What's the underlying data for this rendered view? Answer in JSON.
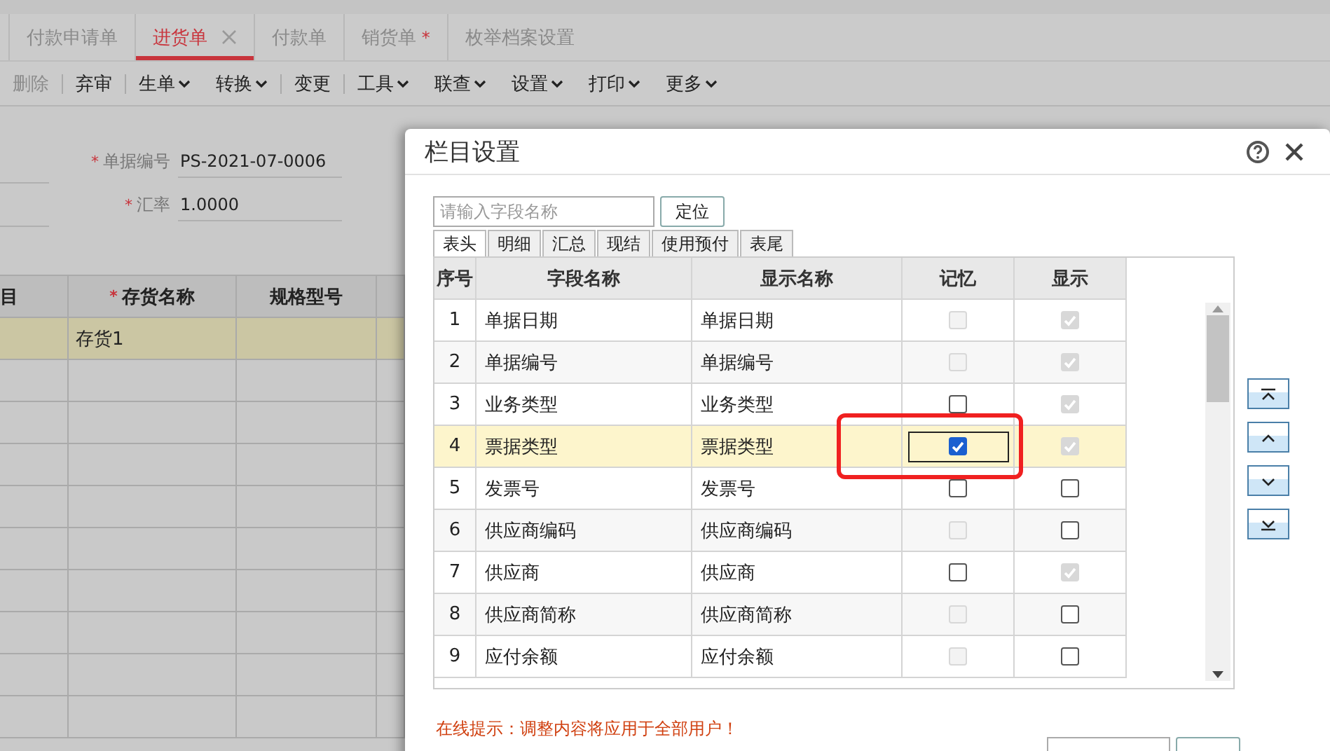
{
  "doc_tabs": [
    {
      "label": "付款申请单",
      "selected": false
    },
    {
      "label": "进货单",
      "selected": true,
      "closable": true
    },
    {
      "label": "付款单",
      "selected": false
    },
    {
      "label": "销货单",
      "selected": false,
      "modified_mark": "*"
    },
    {
      "label": "枚举档案设置",
      "selected": false
    }
  ],
  "toolbar": [
    {
      "label": "删除",
      "disabled": true,
      "dropdown": false
    },
    {
      "label": "弃审",
      "disabled": false,
      "dropdown": false
    },
    {
      "label": "生单",
      "disabled": false,
      "dropdown": true
    },
    {
      "label": "转换",
      "disabled": false,
      "dropdown": true
    },
    {
      "label": "变更",
      "disabled": false,
      "dropdown": false
    },
    {
      "label": "工具",
      "disabled": false,
      "dropdown": true
    },
    {
      "label": "联查",
      "disabled": false,
      "dropdown": true
    },
    {
      "label": "设置",
      "disabled": false,
      "dropdown": true
    },
    {
      "label": "打印",
      "disabled": false,
      "dropdown": true
    },
    {
      "label": "更多",
      "disabled": false,
      "dropdown": true
    }
  ],
  "form": [
    {
      "label": "单据编号",
      "required": true,
      "value": "PS-2021-07-0006"
    },
    {
      "label": "汇率",
      "required": true,
      "value": "1.0000"
    }
  ],
  "grid": {
    "columns": [
      {
        "label": "目",
        "required": false
      },
      {
        "label": "存货名称",
        "required": true
      },
      {
        "label": "规格型号",
        "required": false
      },
      {
        "required": false
      }
    ],
    "rows": [
      {
        "selected": true,
        "cells": [
          "",
          "存货1",
          "",
          ""
        ]
      },
      {
        "selected": false,
        "cells": [
          "",
          "",
          "",
          ""
        ]
      },
      {
        "selected": false,
        "cells": [
          "",
          "",
          "",
          ""
        ]
      },
      {
        "selected": false,
        "cells": [
          "",
          "",
          "",
          ""
        ]
      },
      {
        "selected": false,
        "cells": [
          "",
          "",
          "",
          ""
        ]
      },
      {
        "selected": false,
        "cells": [
          "",
          "",
          "",
          ""
        ]
      },
      {
        "selected": false,
        "cells": [
          "",
          "",
          "",
          ""
        ]
      },
      {
        "selected": false,
        "cells": [
          "",
          "",
          "",
          ""
        ]
      },
      {
        "selected": false,
        "cells": [
          "",
          "",
          "",
          ""
        ]
      },
      {
        "selected": false,
        "cells": [
          "",
          "",
          "",
          ""
        ]
      }
    ]
  },
  "dialog": {
    "title": "栏目设置",
    "search": {
      "placeholder": "请输入字段名称"
    },
    "locate_button": "定位",
    "tabs": [
      {
        "label": "表头",
        "selected": true
      },
      {
        "label": "明细",
        "selected": false
      },
      {
        "label": "汇总",
        "selected": false
      },
      {
        "label": "现结",
        "selected": false
      },
      {
        "label": "使用预付",
        "selected": false
      },
      {
        "label": "表尾",
        "selected": false
      }
    ],
    "columns": [
      "序号",
      "字段名称",
      "显示名称",
      "记忆",
      "显示"
    ],
    "rows": [
      {
        "no": "1",
        "field": "单据日期",
        "display": "单据日期",
        "selected": false,
        "memory": {
          "checked": false,
          "disabled": true
        },
        "show": {
          "checked": true,
          "disabled": true
        }
      },
      {
        "no": "2",
        "field": "单据编号",
        "display": "单据编号",
        "selected": false,
        "memory": {
          "checked": false,
          "disabled": true
        },
        "show": {
          "checked": true,
          "disabled": true
        }
      },
      {
        "no": "3",
        "field": "业务类型",
        "display": "业务类型",
        "selected": false,
        "memory": {
          "checked": false,
          "disabled": false
        },
        "show": {
          "checked": true,
          "disabled": true
        }
      },
      {
        "no": "4",
        "field": "票据类型",
        "display": "票据类型",
        "selected": true,
        "memory": {
          "checked": true,
          "disabled": false
        },
        "show": {
          "checked": true,
          "disabled": true
        }
      },
      {
        "no": "5",
        "field": "发票号",
        "display": "发票号",
        "selected": false,
        "memory": {
          "checked": false,
          "disabled": false
        },
        "show": {
          "checked": false,
          "disabled": false
        }
      },
      {
        "no": "6",
        "field": "供应商编码",
        "display": "供应商编码",
        "selected": false,
        "memory": {
          "checked": false,
          "disabled": true
        },
        "show": {
          "checked": false,
          "disabled": false
        }
      },
      {
        "no": "7",
        "field": "供应商",
        "display": "供应商",
        "selected": false,
        "memory": {
          "checked": false,
          "disabled": false
        },
        "show": {
          "checked": true,
          "disabled": true
        }
      },
      {
        "no": "8",
        "field": "供应商简称",
        "display": "供应商简称",
        "selected": false,
        "memory": {
          "checked": false,
          "disabled": true
        },
        "show": {
          "checked": false,
          "disabled": false
        }
      },
      {
        "no": "9",
        "field": "应付余额",
        "display": "应付余额",
        "selected": false,
        "memory": {
          "checked": false,
          "disabled": true
        },
        "show": {
          "checked": false,
          "disabled": false
        }
      }
    ],
    "move_buttons": [
      {
        "kind": "top"
      },
      {
        "kind": "up"
      },
      {
        "kind": "down"
      },
      {
        "kind": "bottom"
      }
    ],
    "hint": {
      "label": "在线提示：",
      "lines": [
        "调整内容将应用于全部用户！"
      ]
    }
  }
}
